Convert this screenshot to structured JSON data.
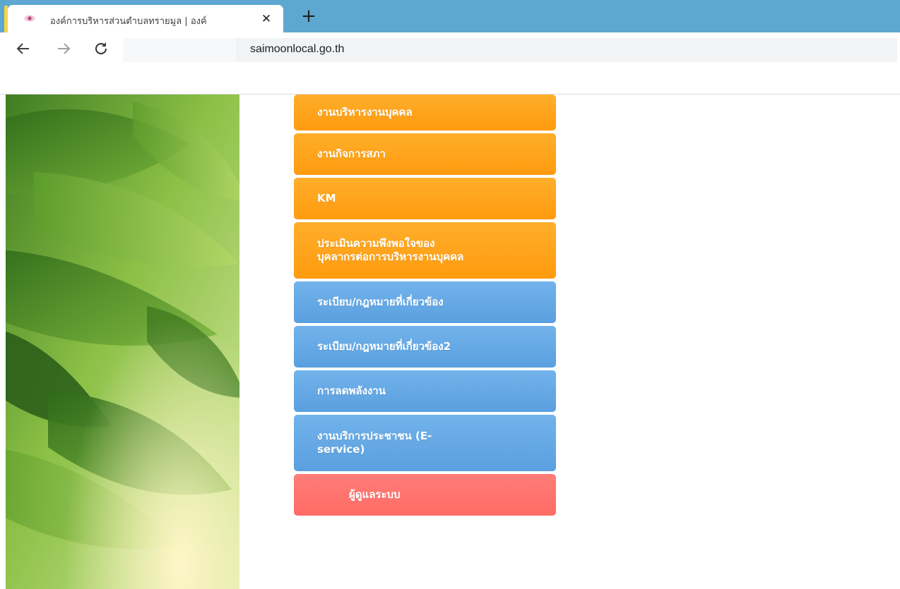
{
  "browser": {
    "tab_title": "องค์การบริหารส่วนตำบลทรายมูล | องค์",
    "close_glyph": "✕",
    "new_tab_glyph": "+",
    "url": "saimoonlocal.go.th"
  },
  "menu": {
    "items": [
      {
        "label": "งานบริหารงานบุคคล",
        "style": "orange"
      },
      {
        "label": "งานกิจการสภา",
        "style": "orange"
      },
      {
        "label": "KM",
        "style": "orange"
      },
      {
        "label": "ประเมินความพึงพอใจของบุคลากรต่อการบริหารงานบุคคล",
        "line1": "ประเมินความพึงพอใจของ",
        "line2": "บุคลากรต่อการบริหารงานบุคคล",
        "style": "orange"
      },
      {
        "label": "ระเบียบ/กฎหมายที่เกี่ยวข้อง",
        "style": "blue"
      },
      {
        "label": "ระเบียบ/กฎหมายที่เกี่ยวข้อง2",
        "style": "blue"
      },
      {
        "label": "การลดพลังงาน",
        "style": "blue"
      },
      {
        "label": "งานบริการประชาชน (E-service)",
        "line1": "งานบริการประชาชน (E-",
        "line2": "service)",
        "style": "blue"
      },
      {
        "label": "ผู้ดูแลระบบ",
        "style": "red"
      }
    ]
  },
  "colors": {
    "orange": "#ffa41e",
    "blue": "#64a8e6",
    "red": "#ff7470",
    "tabstrip": "#5da7d1"
  }
}
